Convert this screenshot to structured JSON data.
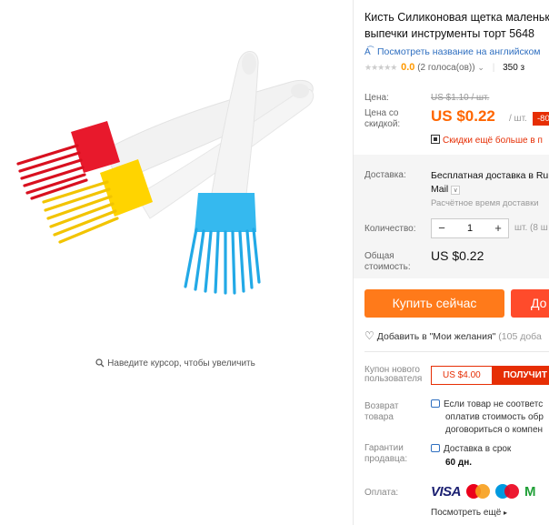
{
  "product": {
    "title_line1": "Кисть Силиконовая щетка маленьк",
    "title_line2": "выпечки инструменты торт 5648",
    "translate_link": "Посмотреть название на английском",
    "rating_value": "0.0",
    "rating_votes": "(2 голоса(ов))",
    "orders": "350 з"
  },
  "pricing": {
    "price_label": "Цена:",
    "old_price": "US $1.10 / шт.",
    "discount_label": "Цена со скидкой:",
    "new_price": "US $0.22",
    "unit": "/ шт.",
    "discount_badge": "-80",
    "promo_text": "Скидки ещё больше в п"
  },
  "shipping": {
    "label": "Доставка:",
    "method_line1": "Бесплатная доставка в Ru",
    "method_line2": "Mail",
    "eta": "Расчётное время доставки"
  },
  "quantity": {
    "label": "Количество:",
    "minus": "−",
    "value": "1",
    "plus": "+",
    "unit_note": "шт. (8 ш"
  },
  "total": {
    "label": "Общая стоимость:",
    "value": "US $0.22"
  },
  "actions": {
    "buy_now": "Купить сейчас",
    "add_to_cart": "До",
    "wishlist_text": "Добавить в \"Мои желания\"",
    "wishlist_count": "(105 доба"
  },
  "coupon": {
    "label": "Купон нового пользователя",
    "amount": "US $4.00",
    "get": "ПОЛУЧИТ"
  },
  "returns": {
    "label": "Возврат товара",
    "line1": "Если товар не соответс",
    "line2": "оплатив стоимость обр",
    "line3": "договориться о компен"
  },
  "guarantee": {
    "label": "Гарантии продавца:",
    "line1": "Доставка в срок",
    "line2": "60 дн."
  },
  "payment": {
    "label": "Оплата:",
    "visa": "VISA",
    "m_brand": "M",
    "more": "Посмотреть ещё"
  },
  "gallery": {
    "zoom_hint": "Наведите курсор, чтобы увеличить"
  },
  "colors": {
    "orange": "#ff7a1a",
    "red": "#e62e04",
    "link": "#2f6fc0"
  },
  "icons": [
    "search-icon",
    "translate-icon",
    "chevron-down-icon",
    "qr-icon",
    "heart-icon",
    "return-icon",
    "guarantee-icon",
    "chevron-right-icon"
  ]
}
